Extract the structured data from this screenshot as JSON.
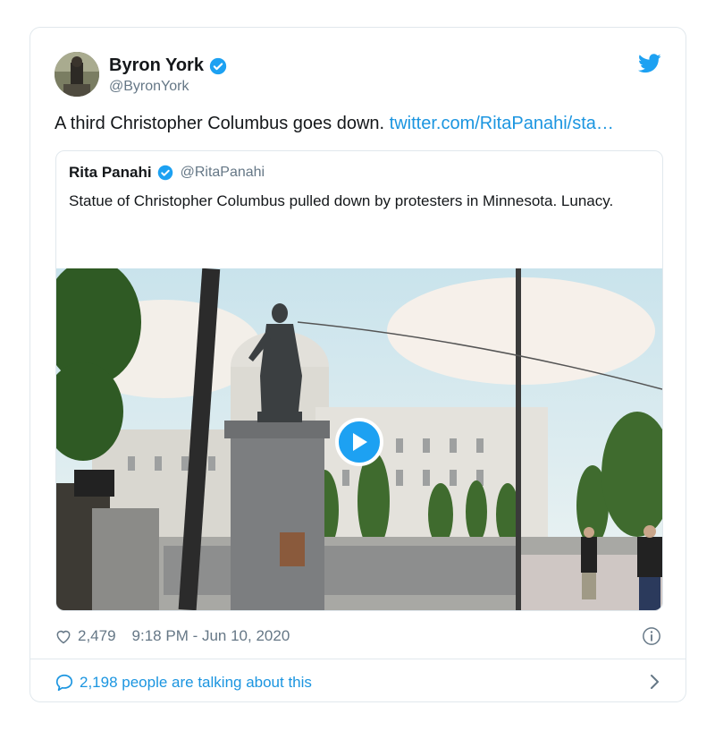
{
  "tweet": {
    "author_name": "Byron York",
    "author_handle": "@ByronYork",
    "text": "A third Christopher Columbus goes down.",
    "link_text": "twitter.com/RitaPanahi/sta…",
    "likes": "2,479",
    "timestamp": "9:18 PM - Jun 10, 2020",
    "conversation_text": "2,198 people are talking about this"
  },
  "quoted": {
    "author_name": "Rita Panahi",
    "author_handle": "@RitaPanahi",
    "text": "Statue of Christopher Columbus pulled down by protesters in Minnesota. Lunacy."
  },
  "colors": {
    "accent": "#1da1f2",
    "link": "#1b95e0",
    "muted": "#657786",
    "border": "#e1e8ed"
  },
  "icons": [
    "verified-badge-icon",
    "twitter-bird-icon",
    "play-icon",
    "heart-icon",
    "info-icon",
    "speech-bubble-icon",
    "chevron-right-icon"
  ]
}
